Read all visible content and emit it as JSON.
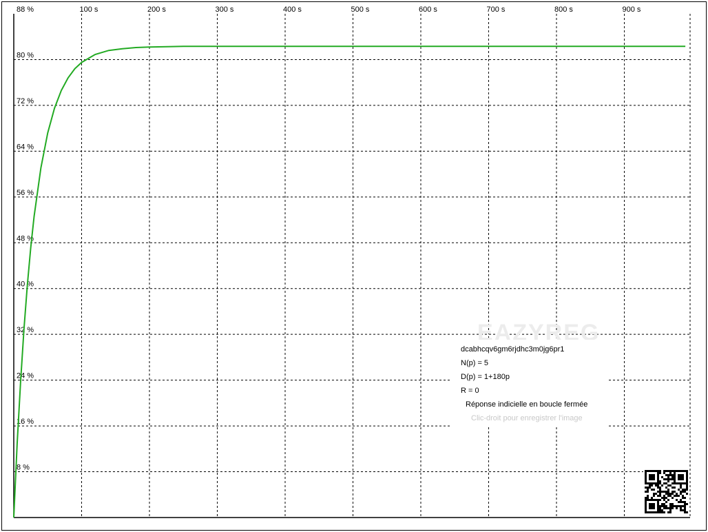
{
  "chart_data": {
    "type": "line",
    "title": "Réponse indicielle en boucle fermée",
    "xlabel": "",
    "ylabel": "",
    "x_unit": "s",
    "y_unit": "%",
    "xlim": [
      0,
      990
    ],
    "ylim": [
      0,
      88
    ],
    "x_ticks": [
      100,
      200,
      300,
      400,
      500,
      600,
      700,
      800,
      900
    ],
    "x_tick_labels": [
      "100 s",
      "200 s",
      "300 s",
      "400 s",
      "500 s",
      "600 s",
      "700 s",
      "800 s",
      "900 s"
    ],
    "y_ticks": [
      8,
      16,
      24,
      32,
      40,
      48,
      56,
      64,
      72,
      80,
      88
    ],
    "y_tick_labels": [
      "8 %",
      "16 %",
      "24 %",
      "32 %",
      "40 %",
      "48 %",
      "56 %",
      "64 %",
      "72 %",
      "80 %",
      "88 %"
    ],
    "grid": true,
    "series": [
      {
        "color": "#22aa22",
        "x": [
          0,
          5,
          10,
          15,
          20,
          25,
          30,
          40,
          50,
          60,
          70,
          80,
          90,
          100,
          120,
          140,
          160,
          180,
          200,
          250,
          300,
          400,
          500,
          600,
          700,
          800,
          900,
          990
        ],
        "y": [
          0,
          12.9,
          23.7,
          32.9,
          40.6,
          47.1,
          52.6,
          61.1,
          67.2,
          71.5,
          74.6,
          76.8,
          78.4,
          79.5,
          80.9,
          81.6,
          81.9,
          82.1,
          82.2,
          82.3,
          82.3,
          82.3,
          82.3,
          82.3,
          82.3,
          82.3,
          82.3,
          82.3
        ]
      }
    ]
  },
  "legend": {
    "id_line": "dcabhcqv6gm6rjdhc3m0jg6pr1",
    "numerator": "N(p) = 5",
    "denominator": "D(p) = 1+180p",
    "r_line": "R = 0",
    "title": "Réponse indicielle en boucle fermée",
    "hint": "Clic-droit pour enregistrer l'image"
  },
  "watermark": "EAZYREG",
  "qr_icon": "qr-code-icon"
}
